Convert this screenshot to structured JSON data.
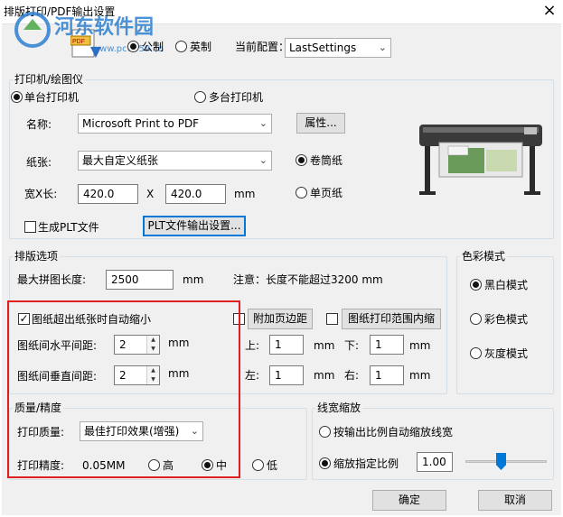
{
  "window": {
    "title": "排版打印/PDF输出设置",
    "close": "×"
  },
  "watermark": {
    "name": "河东软件园",
    "url": "www.pc0359.cn"
  },
  "units": {
    "metric": "公制",
    "imperial": "英制",
    "selected": "metric"
  },
  "config": {
    "label": "当前配置：",
    "value": "LastSettings"
  },
  "printer": {
    "group": "打印机/绘图仪",
    "single": "单台打印机",
    "multi": "多台打印机",
    "selected": "single",
    "name_label": "名称:",
    "name_value": "Microsoft Print to PDF",
    "properties": "属性...",
    "paper_label": "纸张:",
    "paper_value": "最大自定义纸张",
    "roll": "卷筒纸",
    "sheet": "单页纸",
    "paper_mode": "roll",
    "size_label": "宽X长:",
    "width": "420.0",
    "x": "X",
    "length": "420.0",
    "unit": "mm",
    "plt_label": "生成PLT文件",
    "plt_settings": "PLT文件输出设置..."
  },
  "layout": {
    "group": "排版选项",
    "max_len_label": "最大拼图长度:",
    "max_len_value": "2500",
    "max_len_unit": "mm",
    "note": "注意：长度不能超过3200 mm",
    "autoshrink": "图纸超出纸张时自动缩小",
    "autoshrink_checked": true,
    "h_gap_label": "图纸间水平间距:",
    "h_gap": "2",
    "h_gap_unit": "mm",
    "v_gap_label": "图纸间垂直间距:",
    "v_gap": "2",
    "v_gap_unit": "mm",
    "margin_label": "附加页边距",
    "margin_checked": false,
    "range_label": "图纸打印范围内缩",
    "range_checked": false,
    "top_label": "上:",
    "top": "1",
    "bottom_label": "下:",
    "bottom": "1",
    "left_label": "左:",
    "left": "1",
    "right_label": "右:",
    "right": "1",
    "unit": "mm"
  },
  "color": {
    "group": "色彩模式",
    "bw": "黑白模式",
    "color": "彩色模式",
    "gray": "灰度模式",
    "selected": "bw"
  },
  "quality": {
    "group": "质量/精度",
    "quality_label": "打印质量:",
    "quality_value": "最佳打印效果(增强)",
    "precision_label": "打印精度:",
    "precision_value": "0.05MM",
    "high": "高",
    "mid": "中",
    "low": "低",
    "selected": "mid"
  },
  "linewidth": {
    "group": "线宽缩放",
    "auto": "按输出比例自动缩放线宽",
    "fixed": "缩放指定比例",
    "selected": "fixed",
    "ratio": "1.00",
    "slider_fraction": 0.43
  },
  "buttons": {
    "ok": "确定",
    "cancel": "取消"
  },
  "colors": {
    "highlight": "#e02020",
    "accent": "#0078d7"
  }
}
